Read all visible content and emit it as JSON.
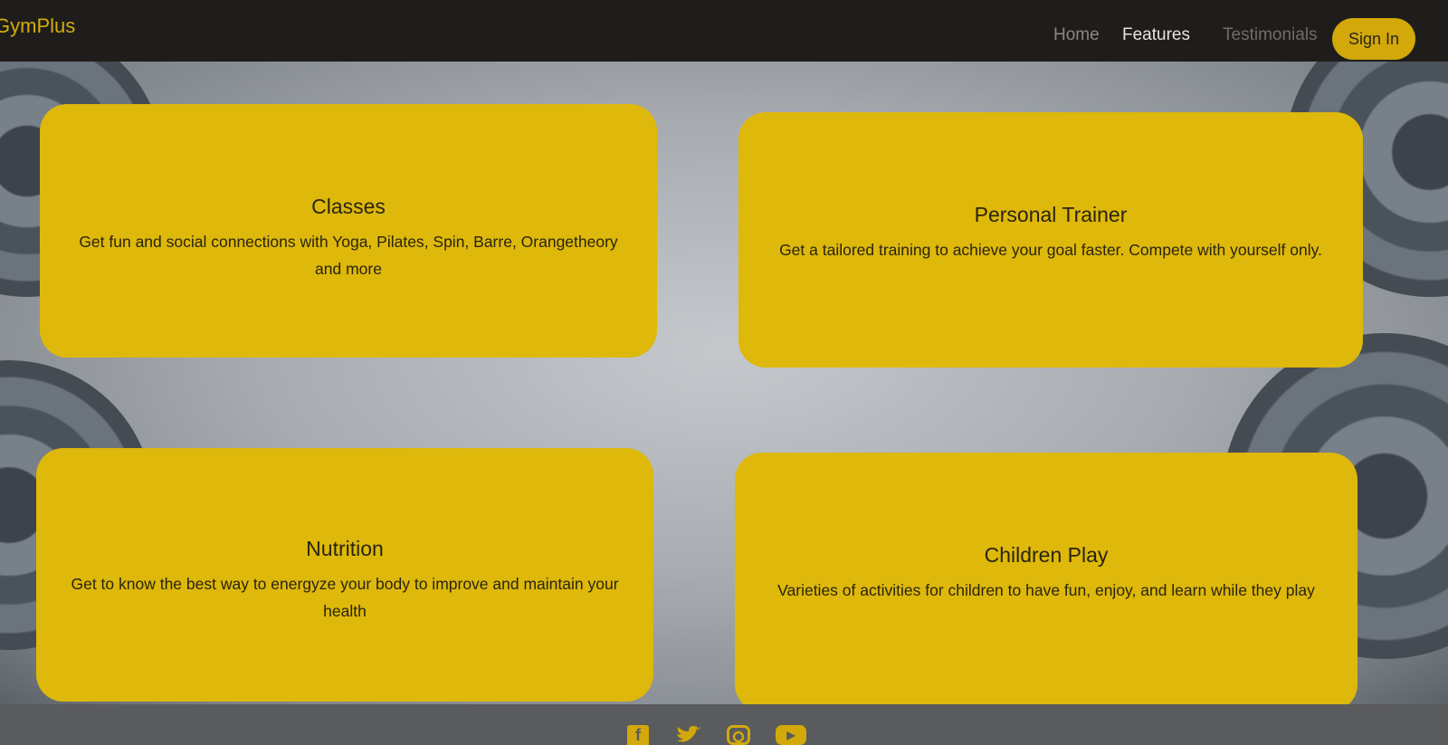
{
  "header": {
    "brand": "GymPlus",
    "nav": [
      "Home",
      "Features",
      "Testimonials"
    ],
    "sign_in": "Sign In"
  },
  "features": [
    {
      "title": "Classes",
      "text": "Get fun and social connections with Yoga, Pilates, Spin, Barre, Orangetheory and more"
    },
    {
      "title": "Personal Trainer",
      "text": "Get a tailored training to achieve your goal faster. Compete with yourself only."
    },
    {
      "title": "Nutrition",
      "text": "Get to know the best way to energyze your body to improve and maintain your health"
    },
    {
      "title": "Children Play",
      "text": "Varieties of activities for children to have fun, enjoy, and learn while they play"
    }
  ],
  "footer": {
    "social": [
      "facebook-icon",
      "twitter-icon",
      "instagram-icon",
      "youtube-icon"
    ]
  },
  "colors": {
    "accent": "#deb80a",
    "topbar": "#1f1d1b"
  }
}
